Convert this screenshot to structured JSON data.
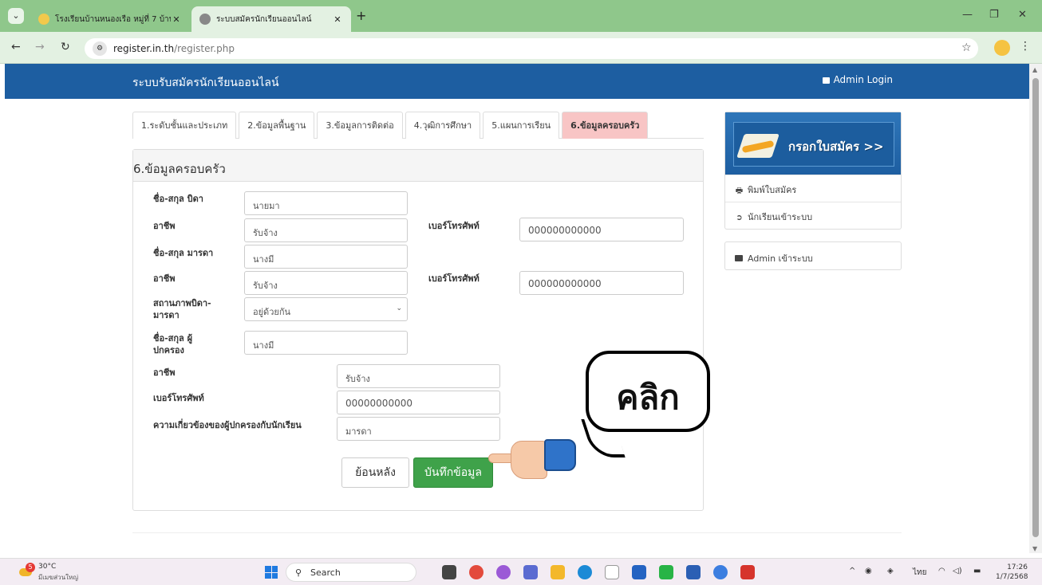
{
  "browser": {
    "tabs": [
      {
        "title": "โรงเรียนบ้านหนองเรือ หมู่ที่ 7 บ้าน"
      },
      {
        "title": "ระบบสมัครนักเรียนออนไลน์"
      }
    ],
    "url_host": "register.in.th",
    "url_path": "/register.php"
  },
  "header": {
    "brand": "ระบบรับสมัครนักเรียนออนไลน์",
    "admin_login": "Admin Login"
  },
  "steps": [
    {
      "label": "1.ระดับชั้นและประเภท"
    },
    {
      "label": "2.ข้อมูลพื้นฐาน"
    },
    {
      "label": "3.ข้อมูลการติดต่อ"
    },
    {
      "label": "4.วุฒิการศึกษา"
    },
    {
      "label": "5.แผนการเรียน"
    },
    {
      "label": "6.ข้อมูลครอบครัว"
    }
  ],
  "panel": {
    "title": "6.ข้อมูลครอบครัว"
  },
  "form": {
    "father_name_label": "ชื่อ-สกุล บิดา",
    "father_name": "นายมา",
    "father_job_label": "อาชีพ",
    "father_job": "รับจ้าง",
    "father_phone_label": "เบอร์โทรศัพท์",
    "father_phone": "000000000000",
    "mother_name_label": "ชื่อ-สกุล มารดา",
    "mother_name": "นางมี",
    "mother_job_label": "อาชีพ",
    "mother_job": "รับจ้าง",
    "mother_phone_label": "เบอร์โทรศัพท์",
    "mother_phone": "000000000000",
    "status_label_1": "สถานภาพบิดา-",
    "status_label_2": "มารดา",
    "status_value": "อยู่ด้วยกัน",
    "guardian_label_1": "ชื่อ-สกุล ผู้",
    "guardian_label_2": "ปกครอง",
    "guardian_name": "นางมี",
    "guardian_job_label": "อาชีพ",
    "guardian_job": "รับจ้าง",
    "guardian_phone_label": "เบอร์โทรศัพท์",
    "guardian_phone": "00000000000",
    "relation_label": "ความเกี่ยวข้องของผู้ปกครองกับนักเรียน",
    "relation": "มารดา",
    "back_button": "ย้อนหลัง",
    "save_button": "บันทึกข้อมูล"
  },
  "sidebar": {
    "banner_text": "กรอกใบสมัคร >>",
    "items": [
      {
        "label": "พิมพ์ใบสมัคร",
        "icon": "printer-icon"
      },
      {
        "label": "นักเรียนเข้าระบบ",
        "icon": "sign-in-icon"
      }
    ],
    "admin": "Admin เข้าระบบ"
  },
  "overlay": {
    "bubble_text": "คลิก"
  },
  "taskbar": {
    "temp": "30°C",
    "weather": "มีเมฆส่วนใหญ่",
    "search": "Search",
    "lang": "ไทย",
    "time": "17:26",
    "date": "1/7/2568"
  },
  "colors": {
    "navbar": "#1d5ea1",
    "active_tab": "#f8c5c5",
    "save_button": "#3fa24a",
    "browser_frame": "#8fc78b"
  }
}
